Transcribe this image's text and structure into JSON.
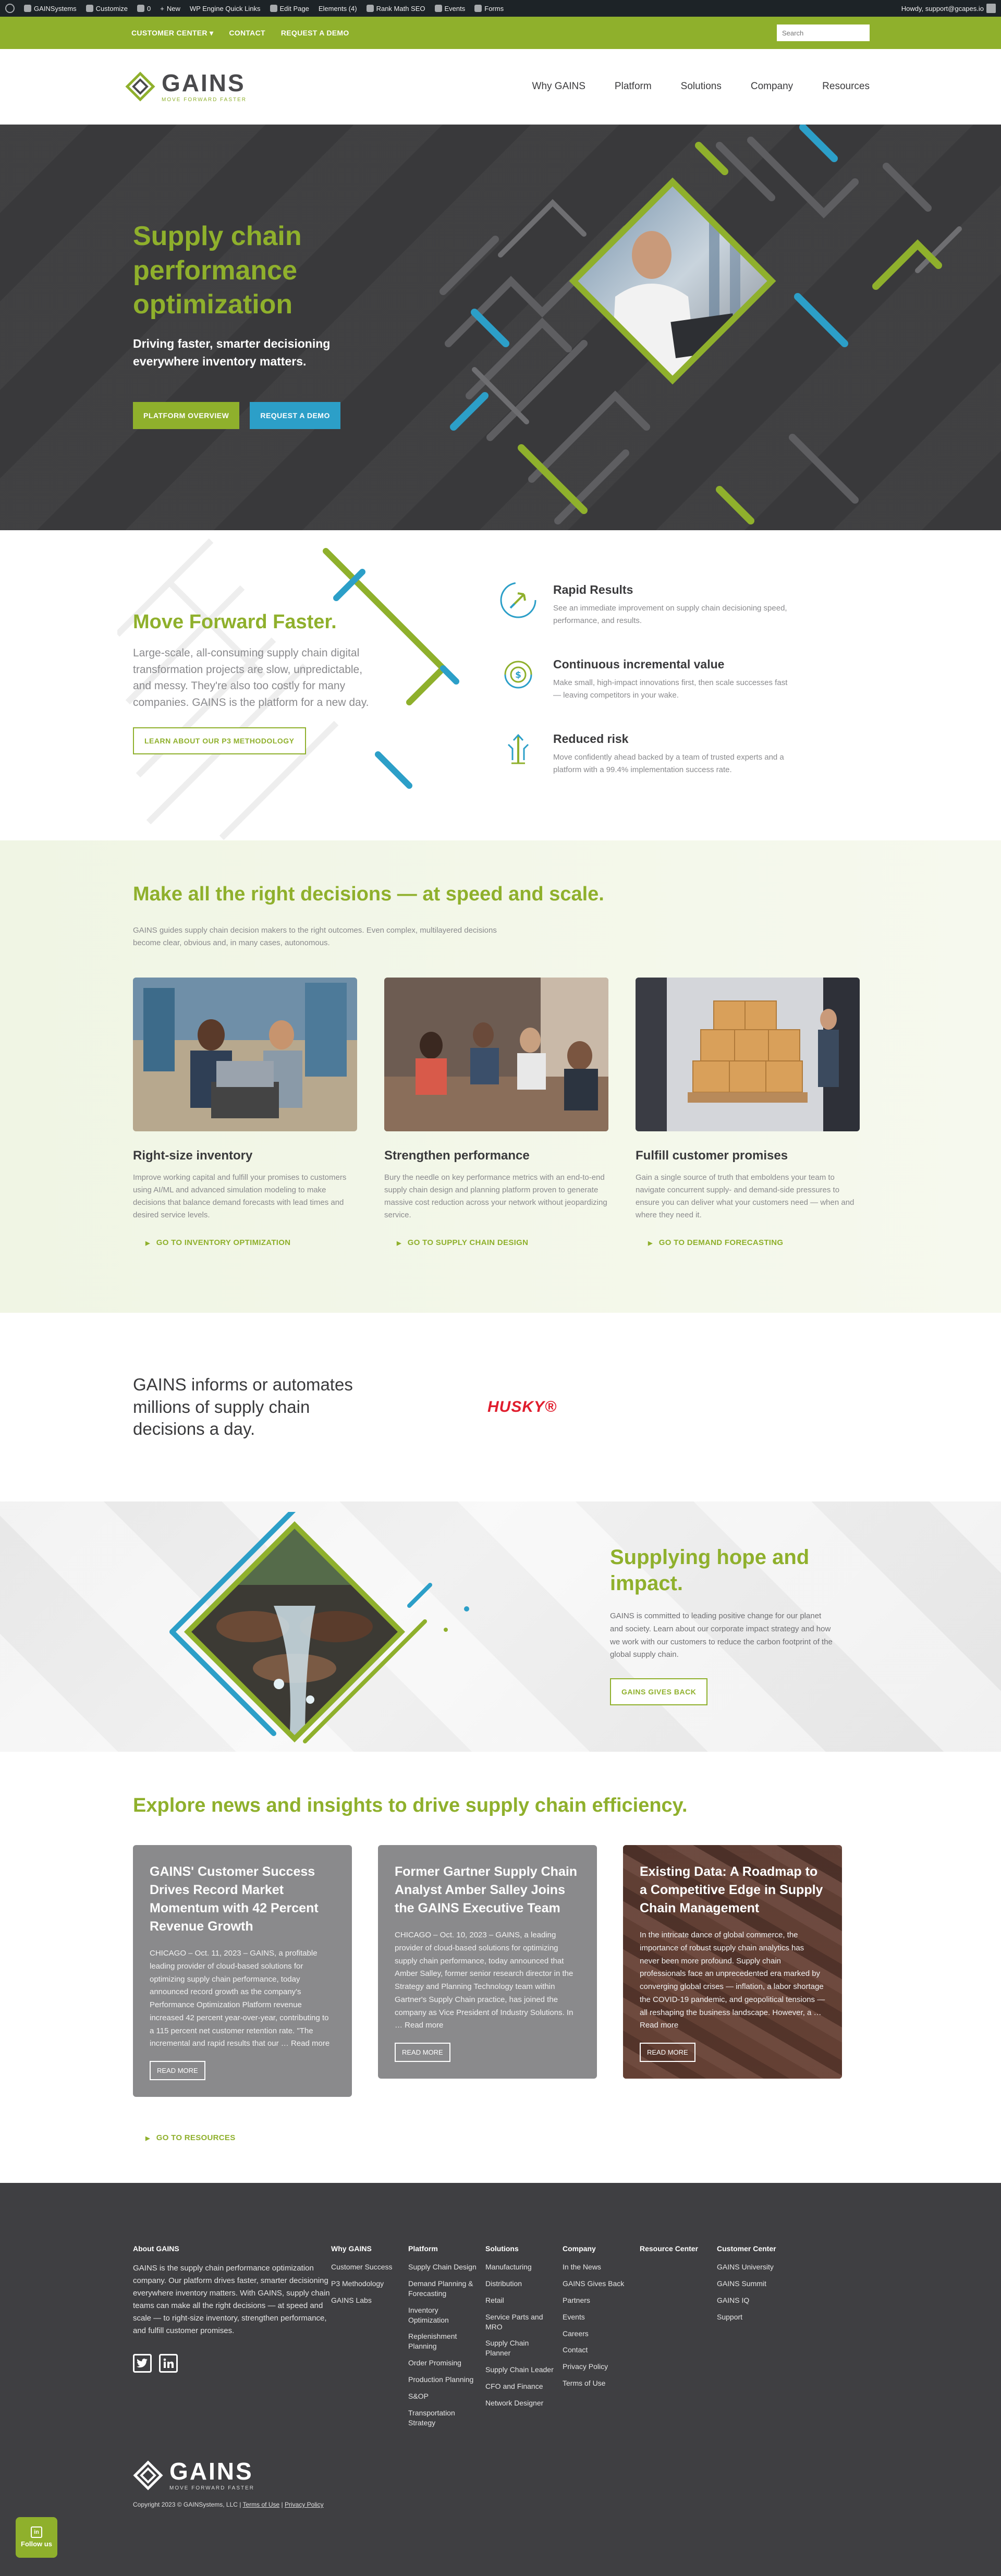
{
  "adminbar": {
    "items": [
      "GAINSystems",
      "Customize",
      "0",
      "New",
      "WP Engine Quick Links",
      "Edit Page",
      "Elements (4)",
      "Rank Math SEO",
      "Events",
      "Forms"
    ],
    "howdy": "Howdy, support@gcapes.io"
  },
  "utility": {
    "links": [
      "CUSTOMER CENTER",
      "CONTACT",
      "REQUEST A DEMO"
    ],
    "search_placeholder": "Search"
  },
  "header": {
    "logo_name": "GAINS",
    "logo_tag": "MOVE FORWARD FASTER",
    "nav": [
      "Why GAINS",
      "Platform",
      "Solutions",
      "Company",
      "Resources"
    ]
  },
  "hero": {
    "title": "Supply chain performance optimization",
    "subtitle": "Driving faster, smarter decisioning everywhere inventory matters.",
    "btn_primary": "PLATFORM OVERVIEW",
    "btn_secondary": "REQUEST A DEMO"
  },
  "moveforward": {
    "title": "Move Forward Faster.",
    "body": "Large-scale, all-consuming supply chain digital transformation projects are slow, unpredictable, and messy. They're also too costly for many companies. GAINS is the platform for a new day.",
    "btn": "LEARN ABOUT OUR P3 METHODOLOGY",
    "features": [
      {
        "title": "Rapid Results",
        "body": "See an immediate improvement on supply chain decisioning speed, performance, and results.",
        "icon": "rocket-icon"
      },
      {
        "title": "Continuous incremental value",
        "body": "Make small, high-impact innovations first, then scale successes fast — leaving competitors in your wake.",
        "icon": "dollar-cycle-icon"
      },
      {
        "title": "Reduced risk",
        "body": "Move confidently ahead backed by a team of trusted experts and a platform with a 99.4% implementation success rate.",
        "icon": "shield-arrows-icon"
      }
    ]
  },
  "decisions": {
    "title": "Make all the right decisions — at speed and scale.",
    "intro": "GAINS guides supply chain decision makers to the right outcomes. Even complex, multilayered decisions become clear, obvious and, in many cases, autonomous.",
    "cards": [
      {
        "title": "Right-size inventory",
        "body": "Improve working capital and fulfill your promises to customers using AI/ML and advanced simulation modeling to make decisions that balance demand forecasts with lead times and desired service levels.",
        "link": "GO TO INVENTORY OPTIMIZATION"
      },
      {
        "title": "Strengthen performance",
        "body": "Bury the needle on key performance metrics with an end-to-end supply chain design and planning platform proven to generate massive cost reduction across your network without jeopardizing service.",
        "link": "GO TO SUPPLY CHAIN DESIGN"
      },
      {
        "title": "Fulfill customer promises",
        "body": "Gain a single source of truth that emboldens your team to navigate concurrent supply- and demand-side pressures to ensure you can deliver what your customers need — when and where they need it.",
        "link": "GO TO DEMAND FORECASTING"
      }
    ]
  },
  "informs": {
    "title": "GAINS informs or automates millions of supply chain decisions a day.",
    "client_logo": "HUSKY"
  },
  "hope": {
    "title": "Supplying hope and impact.",
    "body": "GAINS is committed to leading positive change for our planet and society. Learn about our corporate impact strategy and how we work with our customers to reduce the carbon footprint of the global supply chain.",
    "btn": "GAINS GIVES BACK"
  },
  "news": {
    "title": "Explore news and insights to drive supply chain efficiency.",
    "cards": [
      {
        "title": "GAINS' Customer Success Drives Record Market Momentum with 42 Percent Revenue Growth",
        "body": "CHICAGO – Oct. 11, 2023 – GAINS, a profitable leading provider of cloud-based solutions for optimizing supply chain performance, today announced record growth as the company's Performance Optimization Platform revenue increased 42 percent year-over-year, contributing to a 115 percent net customer retention rate. \"The incremental and rapid results that our … Read more",
        "btn": "READ MORE"
      },
      {
        "title": "Former Gartner Supply Chain Analyst Amber Salley Joins the GAINS Executive Team",
        "body": "CHICAGO – Oct. 10, 2023 – GAINS, a leading provider of cloud-based solutions for optimizing supply chain performance, today announced that Amber Salley, former senior research director in the Strategy and Planning Technology team within Gartner's Supply Chain practice, has joined the company as Vice President of Industry Solutions. In … Read more",
        "btn": "READ MORE"
      },
      {
        "title": "Existing Data: A Roadmap to a Competitive Edge in Supply Chain Management",
        "body": "In the intricate dance of global commerce, the importance of robust supply chain analytics has never been more profound. Supply chain professionals face an unprecedented era marked by converging global crises — inflation, a labor shortage the COVID-19 pandemic, and geopolitical tensions — all reshaping the business landscape. However, a … Read more",
        "btn": "READ MORE"
      }
    ],
    "resources_link": "GO TO RESOURCES"
  },
  "footer": {
    "about_title": "About GAINS",
    "about_body": "GAINS is the supply chain performance optimization company. Our platform drives faster, smarter decisioning everywhere inventory matters. With GAINS, supply chain teams can make all the right decisions — at speed and scale — to right-size inventory, strengthen performance, and fulfill customer promises.",
    "columns": [
      {
        "title": "Why GAINS",
        "items": [
          "Customer Success",
          "P3 Methodology",
          "GAINS Labs"
        ]
      },
      {
        "title": "Platform",
        "items": [
          "Supply Chain Design",
          "Demand Planning & Forecasting",
          "Inventory Optimization",
          "Replenishment Planning",
          "Order Promising",
          "Production Planning",
          "S&OP",
          "Transportation Strategy"
        ]
      },
      {
        "title": "Solutions",
        "items": [
          "Manufacturing",
          "Distribution",
          "Retail",
          "Service Parts and MRO",
          "Supply Chain Planner",
          "Supply Chain Leader",
          "CFO and Finance",
          "Network Designer"
        ]
      },
      {
        "title": "Company",
        "items": [
          "In the News",
          "GAINS Gives Back",
          "Partners",
          "Events",
          "Careers",
          "Contact",
          "Privacy Policy",
          "Terms of Use"
        ]
      },
      {
        "title": "Resource Center",
        "items": []
      },
      {
        "title": "Customer Center",
        "items": [
          "GAINS University",
          "GAINS Summit",
          "GAINS IQ",
          "Support"
        ]
      }
    ],
    "copyright": "Copyright 2023 © GAINSystems, LLC | ",
    "terms": "Terms of Use",
    "privacy": "Privacy Policy",
    "follow": "Follow us"
  },
  "colors": {
    "accent": "#8fb02c",
    "blue": "#2c9fc8",
    "dark": "#3c3c3e",
    "footer": "#3f3f42"
  }
}
